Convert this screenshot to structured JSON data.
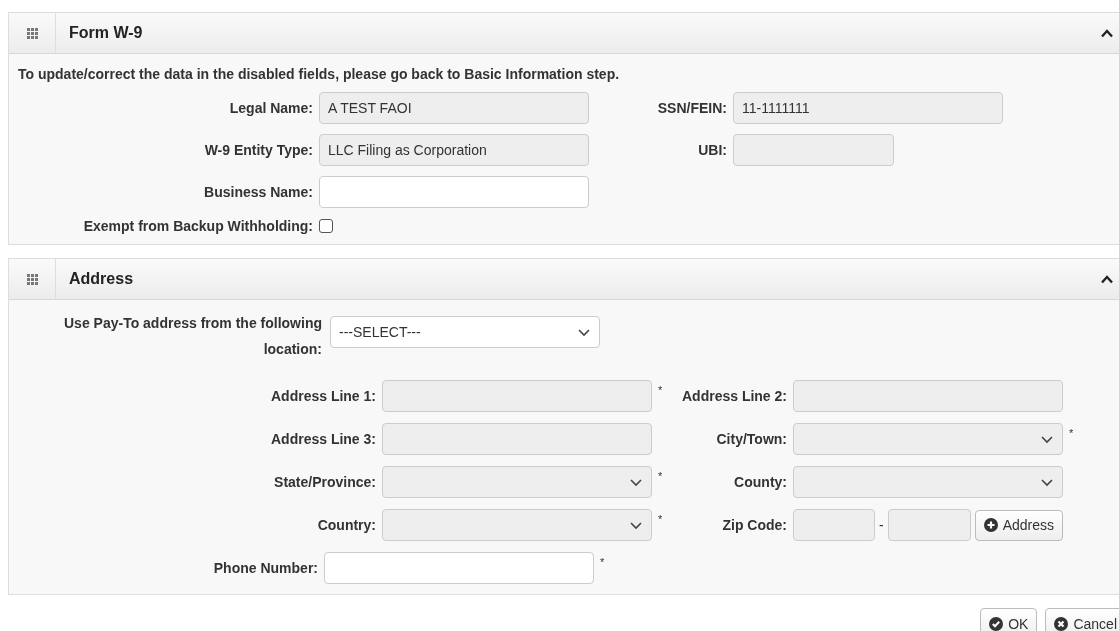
{
  "form_w9": {
    "title": "Form W-9",
    "expanded": true,
    "notice": "To update/correct the data in the disabled fields, please go back to Basic Information step.",
    "rows": [
      [
        {
          "label": "Legal Name:",
          "kind": "text",
          "value": "A TEST FAOI",
          "disabled": true
        },
        {
          "label": "SSN/FEIN:",
          "kind": "text",
          "value": "11-1111111",
          "disabled": true
        }
      ],
      [
        {
          "label": "W-9 Entity Type:",
          "kind": "text",
          "value": "LLC Filing as Corporation",
          "disabled": true
        },
        {
          "label": "UBI:",
          "kind": "text",
          "disabled": true
        }
      ],
      [
        {
          "label": "Business Name:",
          "kind": "text",
          "disabled": false
        }
      ],
      [
        {
          "label": "Exempt from Backup Withholding:",
          "kind": "checkbox",
          "checked": false
        }
      ]
    ]
  },
  "address": {
    "title": "Address",
    "expanded": true,
    "location": {
      "label": "Use Pay-To address from the following location:",
      "kind": "select",
      "value": "---SELECT---",
      "disabled": false
    },
    "rows": [
      [
        {
          "label": "Address Line 1:",
          "kind": "text",
          "disabled": true,
          "required_mark": "*"
        },
        {
          "label": "Address Line 2:",
          "kind": "text",
          "disabled": true
        }
      ],
      [
        {
          "label": "Address Line 3:",
          "kind": "text",
          "disabled": true
        },
        {
          "label": "City/Town:",
          "kind": "select",
          "disabled": true,
          "required_mark": "*"
        }
      ],
      [
        {
          "label": "State/Province:",
          "kind": "select",
          "disabled": true,
          "required_mark": "*"
        },
        {
          "label": "County:",
          "kind": "select",
          "disabled": true
        }
      ],
      [
        {
          "label": "Country:",
          "kind": "select",
          "disabled": true,
          "required_mark": "*"
        },
        {
          "label": "Zip Code:",
          "kind": "zip",
          "separator": "-",
          "disabled": true,
          "button": "Address"
        }
      ]
    ],
    "phone": {
      "label": "Phone Number:",
      "kind": "text",
      "disabled": false,
      "required_mark": "*"
    }
  },
  "buttons": [
    {
      "label": "OK",
      "kind": "ok"
    },
    {
      "label": "Cancel",
      "kind": "cancel"
    }
  ]
}
